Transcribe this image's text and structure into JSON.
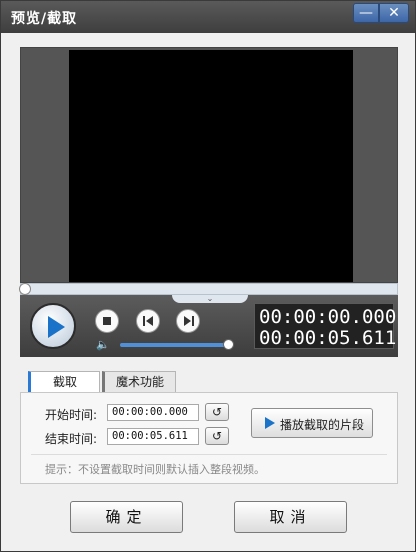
{
  "window": {
    "title": "预览/截取",
    "minimize_glyph": "—",
    "close_glyph": "✕"
  },
  "player": {
    "collapse_glyph": "⌄",
    "volume_glyph": "🔈",
    "current_time": "00:00:00.000",
    "total_time": "00:00:05.611",
    "seek_position": 0,
    "volume_level": 1.0
  },
  "tabs": [
    {
      "label": "截取",
      "active": true
    },
    {
      "label": "魔术功能",
      "active": false
    }
  ],
  "capture": {
    "start_label": "开始时间:",
    "start_value": "00:00:00.000",
    "end_label": "结束时间:",
    "end_value": "00:00:05.611",
    "reset_glyph": "↺",
    "play_clip_label": "播放截取的片段",
    "hint": "提示：不设置截取时间则默认插入整段视频。"
  },
  "buttons": {
    "ok": "确定",
    "cancel": "取消"
  },
  "colors": {
    "accent": "#1a73c8",
    "titlebar": "#3e3e3e",
    "video_bg": "#000000",
    "frame_bg": "#555555"
  }
}
